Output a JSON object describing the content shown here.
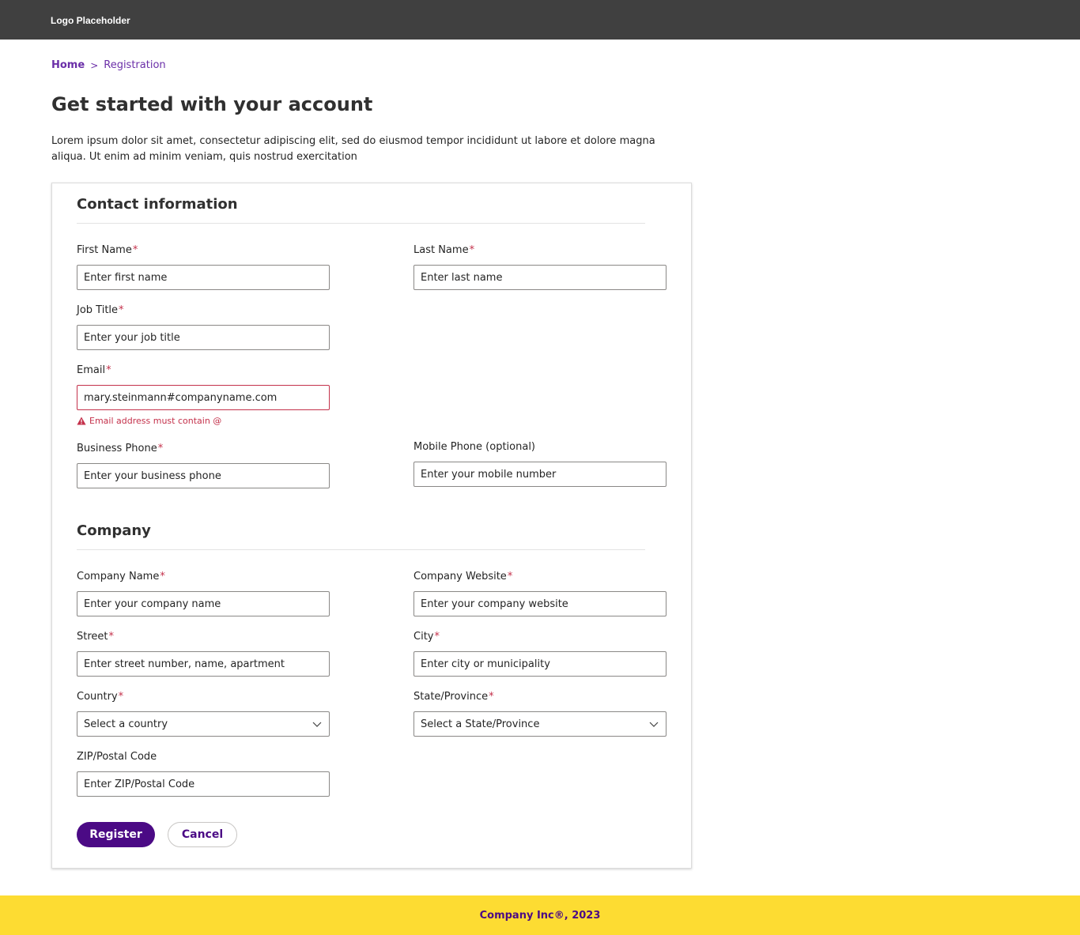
{
  "header": {
    "logo": "Logo Placeholder"
  },
  "breadcrumb": {
    "home": "Home",
    "separator": ">",
    "current": "Registration"
  },
  "page": {
    "title": "Get started with your account",
    "intro": "Lorem ipsum dolor sit amet, consectetur adipiscing elit, sed do eiusmod tempor incididunt ut labore et dolore magna aliqua. Ut enim ad minim veniam, quis nostrud exercitation"
  },
  "required_marker": "*",
  "contact": {
    "title": "Contact information",
    "first_name": {
      "label": "First Name",
      "placeholder": "Enter first name"
    },
    "last_name": {
      "label": "Last Name",
      "placeholder": "Enter last name"
    },
    "job_title": {
      "label": "Job Title",
      "placeholder": "Enter your job title"
    },
    "email": {
      "label": "Email",
      "value": "mary.steinmann#companyname.com",
      "error": "Email address must contain @"
    },
    "business_phone": {
      "label": "Business Phone",
      "placeholder": "Enter your business phone"
    },
    "mobile_phone": {
      "label": "Mobile Phone (optional)",
      "placeholder": "Enter your mobile number"
    }
  },
  "company": {
    "title": "Company",
    "name": {
      "label": "Company Name",
      "placeholder": "Enter your company name"
    },
    "website": {
      "label": "Company Website",
      "placeholder": "Enter your company website"
    },
    "street": {
      "label": "Street",
      "placeholder": "Enter street number, name, apartment"
    },
    "city": {
      "label": "City",
      "placeholder": "Enter city or municipality"
    },
    "country": {
      "label": "Country",
      "selected": "Select a country"
    },
    "state": {
      "label": "State/Province",
      "selected": "Select a State/Province"
    },
    "zip": {
      "label": "ZIP/Postal Code",
      "placeholder": "Enter ZIP/Postal Code"
    }
  },
  "actions": {
    "register": "Register",
    "cancel": "Cancel"
  },
  "footer": {
    "text": "Company Inc®, 2023"
  },
  "colors": {
    "topbar": "#404040",
    "accent": "#4b0a85",
    "link": "#6b2fa8",
    "error": "#c4314b",
    "footer": "#fddc32"
  },
  "icons": {
    "error": "warning-triangle-icon",
    "dropdown": "chevron-down-icon"
  }
}
